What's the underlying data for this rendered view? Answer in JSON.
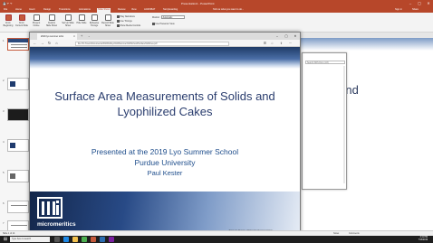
{
  "powerpoint": {
    "title": "Presentation1 - PowerPoint",
    "tabs": [
      "File",
      "Home",
      "Insert",
      "Design",
      "Transitions",
      "Animations",
      "Slide Show",
      "Review",
      "View",
      "ACROBAT",
      "Storyboarding",
      "Tell me what you want to do..."
    ],
    "active_tab": "Slide Show",
    "sign_in": "Sign in",
    "share": "Share",
    "ribbon": {
      "from_beginning": "From Beginning",
      "from_current": "From Current Slide",
      "present_online": "Present Online",
      "custom_show": "Custom Slide Show",
      "set_up": "Set Up Slide Show",
      "hide_slide": "Hide Slide",
      "rehearse": "Rehearse Timings",
      "record": "Record Slide Show",
      "play_narrations": "Play Narrations",
      "use_timings": "Use Timings",
      "show_media": "Show Media Controls",
      "monitor_label": "Monitor:",
      "monitor_value": "Automatic",
      "presenter_view": "Use Presenter View",
      "group_start": "Start Slide Show",
      "group_setup": "Set Up",
      "group_monitors": "Monitors"
    },
    "thumbnails": [
      "1",
      "2",
      "3",
      "4",
      "5",
      "6",
      "7"
    ],
    "behind_slide_text": "s and",
    "statusbar": {
      "slide_info": "Slide 1 of 14",
      "notes": "Notes",
      "comments": "Comments"
    }
  },
  "browser": {
    "tab_title": "2019 lyo summer scho",
    "url": "file:///C:/Users/Documents/2019%20Lyo%20Summer%20School/Surface%20Area.pdf",
    "second_window_search": "Search SDS Docs (ctrl)"
  },
  "slide": {
    "title_line1": "Surface Area Measurements of Solids and",
    "title_line2": "Lyophilized Cakes",
    "presented_at": "Presented at the 2019 Lyo Summer School",
    "university": "Purdue University",
    "presenter": "Paul Kester",
    "logo_text": "micromeritics",
    "footer": "Strategic Division of Material Characterization"
  },
  "taskbar": {
    "search_placeholder": "Type here to search",
    "time": "3:11 PM",
    "date": "7/16/2019"
  },
  "colors": {
    "ppt_accent": "#b7472a",
    "slide_title": "#2a3d6e",
    "slide_subtitle": "#1f4e8c"
  }
}
